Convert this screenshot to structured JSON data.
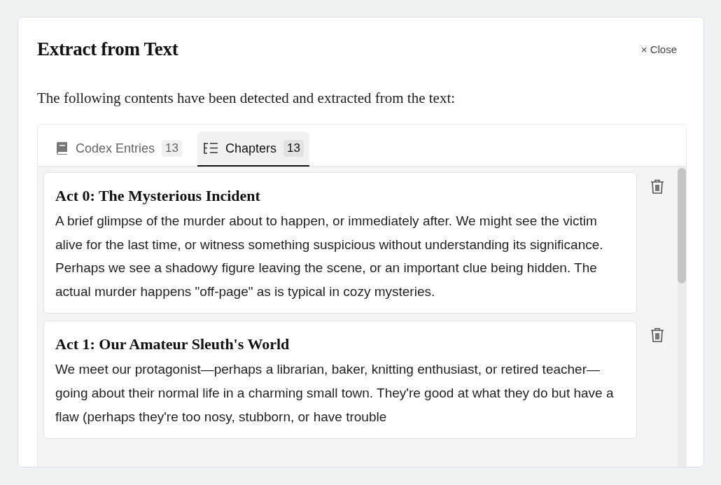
{
  "dialog": {
    "title": "Extract from Text",
    "close_label": "× Close",
    "intro": "The following contents have been detected and extracted from the text:"
  },
  "tabs": [
    {
      "label": "Codex Entries",
      "count": "13",
      "kind": "book",
      "selected": false
    },
    {
      "label": "Chapters",
      "count": "13",
      "kind": "outline",
      "selected": true
    }
  ],
  "chapters": [
    {
      "title": "Act 0: The Mysterious Incident",
      "summary": "A brief glimpse of the murder about to happen, or immediately after. We might see the victim alive for the last time, or witness something suspicious without understanding its significance. Perhaps we see a shadowy figure leaving the scene, or an important clue being hidden. The actual murder happens \"off-page\" as is typical in cozy mysteries."
    },
    {
      "title": "Act 1: Our Amateur Sleuth's World",
      "summary": "We meet our protagonist—perhaps a librarian, baker, knitting enthusiast, or retired teacher—going about their normal life in a charming small town. They're good at what they do but have a flaw (perhaps they're too nosy, stubborn, or have trouble"
    }
  ]
}
